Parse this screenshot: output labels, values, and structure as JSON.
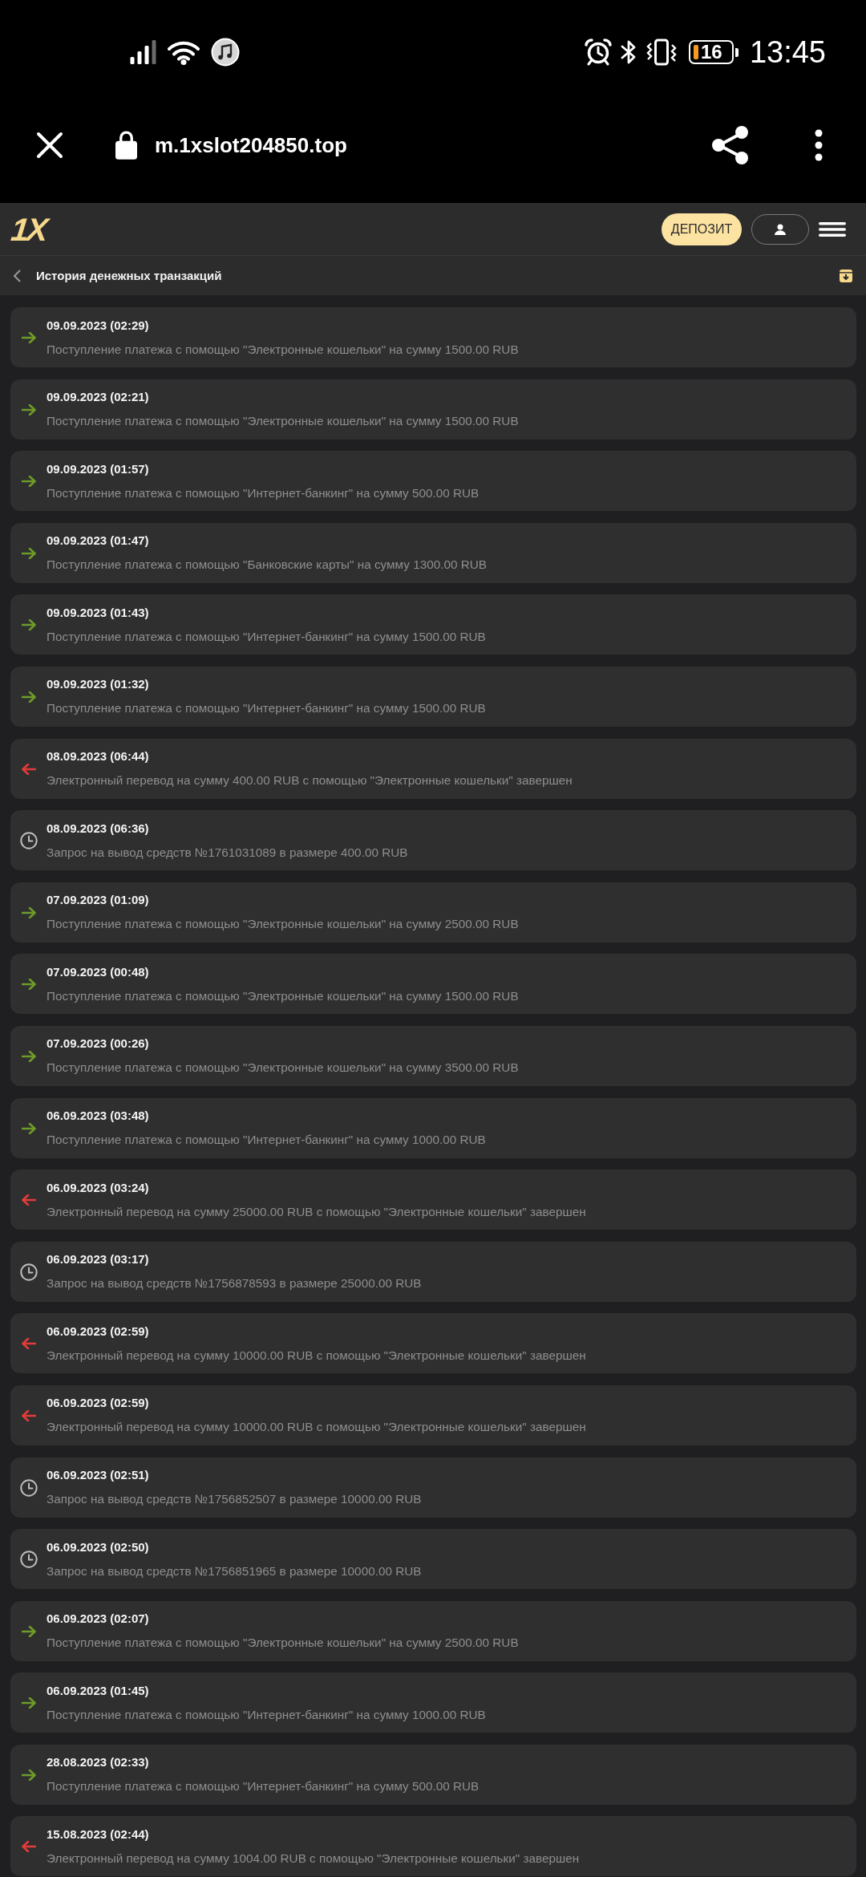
{
  "status_bar": {
    "battery": "16",
    "time": "13:45"
  },
  "browser_bar": {
    "url": "m.1xslot204850.top"
  },
  "header": {
    "logo": "1X",
    "deposit_button": "ДЕПОЗИТ"
  },
  "page_title": "История денежных транзакций",
  "transactions": [
    {
      "kind": "incoming",
      "date": "09.09.2023 (02:29)",
      "description": "Поступление платежа с помощью \"Электронные кошельки\" на сумму 1500.00 RUB"
    },
    {
      "kind": "incoming",
      "date": "09.09.2023 (02:21)",
      "description": "Поступление платежа с помощью \"Электронные кошельки\" на сумму 1500.00 RUB"
    },
    {
      "kind": "incoming",
      "date": "09.09.2023 (01:57)",
      "description": "Поступление платежа с помощью \"Интернет-банкинг\" на сумму 500.00 RUB"
    },
    {
      "kind": "incoming",
      "date": "09.09.2023 (01:47)",
      "description": "Поступление платежа с помощью \"Банковские карты\" на сумму 1300.00 RUB"
    },
    {
      "kind": "incoming",
      "date": "09.09.2023 (01:43)",
      "description": "Поступление платежа с помощью \"Интернет-банкинг\" на сумму 1500.00 RUB"
    },
    {
      "kind": "incoming",
      "date": "09.09.2023 (01:32)",
      "description": "Поступление платежа с помощью \"Интернет-банкинг\" на сумму 1500.00 RUB"
    },
    {
      "kind": "outgoing",
      "date": "08.09.2023 (06:44)",
      "description": "Электронный перевод на сумму 400.00 RUB с помощью \"Электронные кошельки\" завершен"
    },
    {
      "kind": "pending",
      "date": "08.09.2023 (06:36)",
      "description": "Запрос на вывод средств №1761031089 в размере 400.00 RUB"
    },
    {
      "kind": "incoming",
      "date": "07.09.2023 (01:09)",
      "description": "Поступление платежа с помощью \"Электронные кошельки\" на сумму 2500.00 RUB"
    },
    {
      "kind": "incoming",
      "date": "07.09.2023 (00:48)",
      "description": "Поступление платежа с помощью \"Электронные кошельки\" на сумму 1500.00 RUB"
    },
    {
      "kind": "incoming",
      "date": "07.09.2023 (00:26)",
      "description": "Поступление платежа с помощью \"Электронные кошельки\" на сумму 3500.00 RUB"
    },
    {
      "kind": "incoming",
      "date": "06.09.2023 (03:48)",
      "description": "Поступление платежа с помощью \"Интернет-банкинг\" на сумму 1000.00 RUB"
    },
    {
      "kind": "outgoing",
      "date": "06.09.2023 (03:24)",
      "description": "Электронный перевод на сумму 25000.00 RUB с помощью \"Электронные кошельки\" завершен"
    },
    {
      "kind": "pending",
      "date": "06.09.2023 (03:17)",
      "description": "Запрос на вывод средств №1756878593 в размере 25000.00 RUB"
    },
    {
      "kind": "outgoing",
      "date": "06.09.2023 (02:59)",
      "description": "Электронный перевод на сумму 10000.00 RUB с помощью \"Электронные кошельки\" завершен"
    },
    {
      "kind": "outgoing",
      "date": "06.09.2023 (02:59)",
      "description": "Электронный перевод на сумму 10000.00 RUB с помощью \"Электронные кошельки\" завершен"
    },
    {
      "kind": "pending",
      "date": "06.09.2023 (02:51)",
      "description": "Запрос на вывод средств №1756852507 в размере 10000.00 RUB"
    },
    {
      "kind": "pending",
      "date": "06.09.2023 (02:50)",
      "description": "Запрос на вывод средств №1756851965 в размере 10000.00 RUB"
    },
    {
      "kind": "incoming",
      "date": "06.09.2023 (02:07)",
      "description": "Поступление платежа с помощью \"Электронные кошельки\" на сумму 2500.00 RUB"
    },
    {
      "kind": "incoming",
      "date": "06.09.2023 (01:45)",
      "description": "Поступление платежа с помощью \"Интернет-банкинг\" на сумму 1000.00 RUB"
    },
    {
      "kind": "incoming",
      "date": "28.08.2023 (02:33)",
      "description": "Поступление платежа с помощью \"Интернет-банкинг\" на сумму 500.00 RUB"
    },
    {
      "kind": "outgoing",
      "date": "15.08.2023 (02:44)",
      "description": "Электронный перевод на сумму 1004.00 RUB с помощью \"Электронные кошельки\" завершен"
    }
  ]
}
